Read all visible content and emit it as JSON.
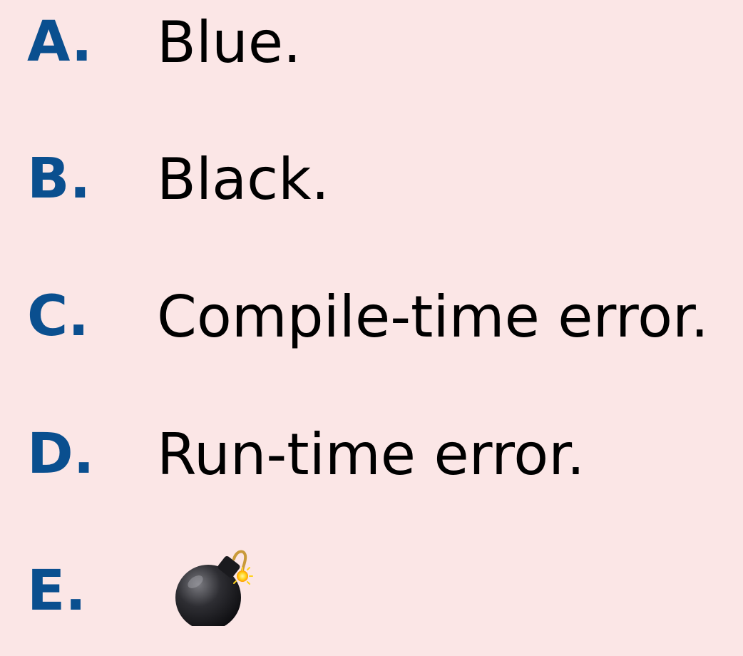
{
  "options": [
    {
      "letter": "A.",
      "text": "Blue."
    },
    {
      "letter": "B.",
      "text": "Black."
    },
    {
      "letter": "C.",
      "text": "Compile-time error."
    },
    {
      "letter": "D.",
      "text": "Run-time error."
    },
    {
      "letter": "E.",
      "icon": "bomb-icon"
    }
  ],
  "colors": {
    "background": "#fbe6e6",
    "letter": "#0a4f8f",
    "text": "#000000"
  }
}
